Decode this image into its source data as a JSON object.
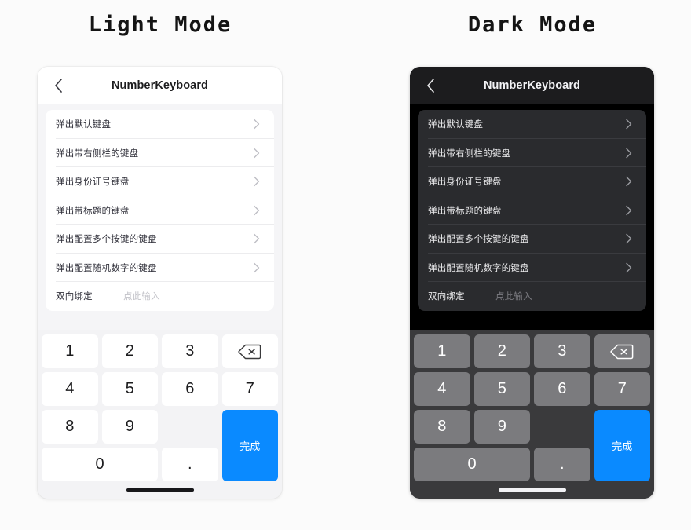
{
  "panels": [
    {
      "title": "Light Mode",
      "theme": "light",
      "nav": {
        "back_icon": "chevron-left-icon",
        "title": "NumberKeyboard"
      },
      "list": [
        {
          "label": "弹出默认键盘",
          "accessory": "chevron-right-icon"
        },
        {
          "label": "弹出带右侧栏的键盘",
          "accessory": "chevron-right-icon"
        },
        {
          "label": "弹出身份证号键盘",
          "accessory": "chevron-right-icon"
        },
        {
          "label": "弹出带标题的键盘",
          "accessory": "chevron-right-icon"
        },
        {
          "label": "弹出配置多个按键的键盘",
          "accessory": "chevron-right-icon"
        },
        {
          "label": "弹出配置随机数字的键盘",
          "accessory": "chevron-right-icon"
        }
      ],
      "binding_row": {
        "label": "双向绑定",
        "value": "",
        "placeholder": "点此输入"
      },
      "keyboard": {
        "keys": [
          "1",
          "2",
          "3",
          "4",
          "5",
          "6",
          "7",
          "8",
          "9",
          "0",
          "."
        ],
        "delete_icon": "backspace-icon",
        "done_label": "完成",
        "done_color": "#0a8aff"
      }
    },
    {
      "title": "Dark Mode",
      "theme": "dark",
      "nav": {
        "back_icon": "chevron-left-icon",
        "title": "NumberKeyboard"
      },
      "list": [
        {
          "label": "弹出默认键盘",
          "accessory": "chevron-right-icon"
        },
        {
          "label": "弹出带右侧栏的键盘",
          "accessory": "chevron-right-icon"
        },
        {
          "label": "弹出身份证号键盘",
          "accessory": "chevron-right-icon"
        },
        {
          "label": "弹出带标题的键盘",
          "accessory": "chevron-right-icon"
        },
        {
          "label": "弹出配置多个按键的键盘",
          "accessory": "chevron-right-icon"
        },
        {
          "label": "弹出配置随机数字的键盘",
          "accessory": "chevron-right-icon"
        }
      ],
      "binding_row": {
        "label": "双向绑定",
        "value": "",
        "placeholder": "点此输入"
      },
      "keyboard": {
        "keys": [
          "1",
          "2",
          "3",
          "4",
          "5",
          "6",
          "7",
          "8",
          "9",
          "0",
          "."
        ],
        "delete_icon": "backspace-icon",
        "done_label": "完成",
        "done_color": "#0a8aff"
      }
    }
  ]
}
